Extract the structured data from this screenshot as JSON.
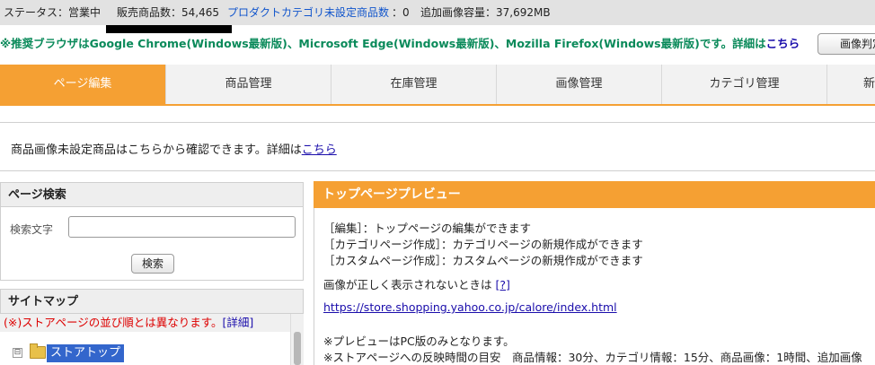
{
  "status": {
    "state": "ステータス：営業中",
    "items_count": "販売商品数：54,465",
    "unset_category_label": "プロダクトカテゴリ未設定商品数",
    "unset_category_value": "：0",
    "extra_image_capacity": "追加画像容量：37,692MB"
  },
  "notice": {
    "text": "※推奨ブラウザはGoogle Chrome(Windows最新版)、Microsoft Edge(Windows最新版)、Mozilla Firefox(Windows最新版)です。詳細は",
    "link": "こちら",
    "button": "画像判定"
  },
  "tabs": [
    {
      "label": "ページ編集",
      "active": true
    },
    {
      "label": "商品管理"
    },
    {
      "label": "在庫管理"
    },
    {
      "label": "画像管理"
    },
    {
      "label": "カテゴリ管理"
    },
    {
      "label": "新"
    }
  ],
  "info": {
    "text": "商品画像未設定商品はこちらから確認できます。詳細は",
    "link": "こちら"
  },
  "page_search": {
    "title": "ページ検索",
    "label": "検索文字",
    "input_value": "",
    "button": "検索"
  },
  "sitemap": {
    "title": "サイトマップ",
    "note": "(※)ストアページの並び順とは異なります。",
    "note_link": "[詳細]",
    "expander": "⊟",
    "root": "ストアトップ"
  },
  "preview": {
    "title": "トップページプレビュー",
    "lines": [
      "［編集］：トップページの編集ができます",
      "［カテゴリページ作成］：カテゴリページの新規作成ができます",
      "［カスタムページ作成］：カスタムページの新規作成ができます"
    ],
    "image_help_text": "画像が正しく表示されないときは",
    "image_help_link": "[?]",
    "url": "https://store.shopping.yahoo.co.jp/calore/index.html",
    "note1": "※プレビューはPC版のみとなります。",
    "note2": "※ストアページへの反映時間の目安　商品情報：30分、カテゴリ情報：15分、商品画像：1時間、追加画像"
  },
  "colors": {
    "accent": "#f5a033",
    "notice_green": "#0a8a5a",
    "link_blue": "#1a0dab",
    "warning_red": "#dd0000",
    "selection_blue": "#3366cc"
  }
}
